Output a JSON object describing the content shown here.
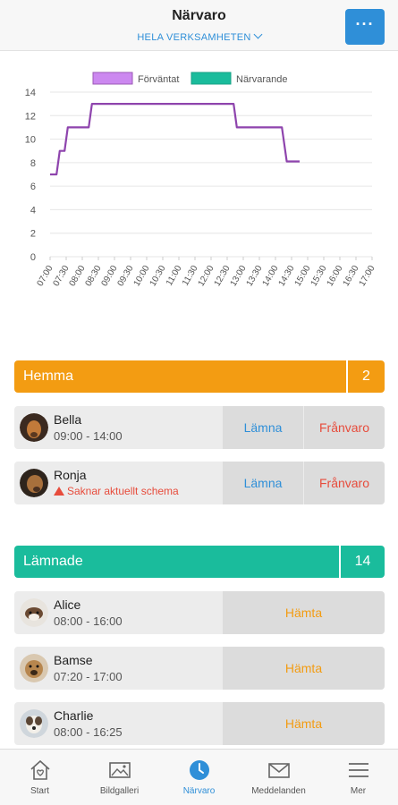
{
  "header": {
    "title": "Närvaro",
    "subtitle": "HELA VERKSAMHETEN",
    "more_label": "···"
  },
  "chart_data": {
    "type": "line",
    "legend": [
      "Förväntat",
      "Närvarande"
    ],
    "legend_colors": [
      "#cc88f0",
      "#1abc9c"
    ],
    "categories": [
      "07:00",
      "07:30",
      "08:00",
      "08:30",
      "09:00",
      "09:30",
      "10:00",
      "10:30",
      "11:00",
      "11:30",
      "12:00",
      "12:30",
      "13:00",
      "13:30",
      "14:00",
      "14:30",
      "15:00",
      "15:30",
      "16:00",
      "16:30",
      "17:00"
    ],
    "yticks": [
      "0",
      "2",
      "4",
      "6",
      "8",
      "10",
      "12",
      "14"
    ],
    "ylim": [
      0,
      14
    ],
    "series": [
      {
        "name": "Förväntat",
        "color": "#8e44ad",
        "points": [
          [
            0,
            7
          ],
          [
            0.4,
            7
          ],
          [
            0.6,
            9
          ],
          [
            0.9,
            9
          ],
          [
            1.1,
            11
          ],
          [
            2.4,
            11
          ],
          [
            2.6,
            13
          ],
          [
            11.4,
            13
          ],
          [
            11.6,
            11
          ],
          [
            14.4,
            11
          ],
          [
            14.7,
            8.1
          ],
          [
            15.5,
            8.1
          ]
        ]
      }
    ],
    "legend_placement": "top-center",
    "grid": true
  },
  "hemma": {
    "title": "Hemma",
    "count": "2",
    "children": [
      {
        "name": "Bella",
        "time": "09:00 - 14:00",
        "left_label": "Lämna",
        "absence_label": "Frånvaro"
      },
      {
        "name": "Ronja",
        "warning": "Saknar aktuellt schema",
        "left_label": "Lämna",
        "absence_label": "Frånvaro"
      }
    ]
  },
  "lamnade": {
    "title": "Lämnade",
    "count": "14",
    "children": [
      {
        "name": "Alice",
        "time": "08:00 - 16:00",
        "pickup_label": "Hämta"
      },
      {
        "name": "Bamse",
        "time": "07:20 - 17:00",
        "pickup_label": "Hämta"
      },
      {
        "name": "Charlie",
        "time": "08:00 - 16:25",
        "pickup_label": "Hämta"
      }
    ]
  },
  "tabs": [
    {
      "label": "Start",
      "icon": "home-heart-icon"
    },
    {
      "label": "Bildgalleri",
      "icon": "image-icon"
    },
    {
      "label": "Närvaro",
      "icon": "clock-icon",
      "active": true
    },
    {
      "label": "Meddelanden",
      "icon": "envelope-icon"
    },
    {
      "label": "Mer",
      "icon": "menu-icon"
    }
  ],
  "colors": {
    "accent": "#2f8fd8",
    "hemma": "#f39c12",
    "lamnade": "#1abc9c",
    "danger": "#e74c3c"
  }
}
